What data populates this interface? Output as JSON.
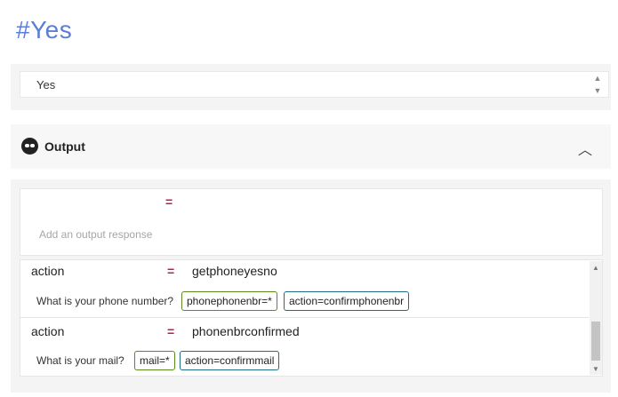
{
  "page": {
    "title": "#Yes"
  },
  "input": {
    "value": "Yes",
    "scroll_up_icon": "triangle-up",
    "scroll_down_icon": "triangle-down"
  },
  "output": {
    "icon": "output-glasses-icon",
    "label": "Output",
    "collapse_icon": "chevron-up"
  },
  "add_response": {
    "equals": "=",
    "placeholder": "Add an output response"
  },
  "responses": [
    {
      "key": "action",
      "equals": "=",
      "value": "getphoneyesno",
      "question": "What is your phone number?",
      "chips": [
        {
          "text": "phonephonenbr=*",
          "color": "#5c8a1e"
        },
        {
          "text": "action=confirmphonenbr",
          "color": "#1f6e86"
        }
      ]
    },
    {
      "key": "action",
      "equals": "=",
      "value": "phonenbrconfirmed",
      "question": "What is your mail?",
      "chips": [
        {
          "text": "mail=*",
          "color": "#5c8a1e"
        },
        {
          "text": "action=confirmmail",
          "color": "#1f6e86"
        }
      ]
    }
  ],
  "colors": {
    "title": "#5b7fd6",
    "equals": "#c2185b",
    "chip_green": "#5c8a1e",
    "chip_blue": "#1f6e86"
  }
}
